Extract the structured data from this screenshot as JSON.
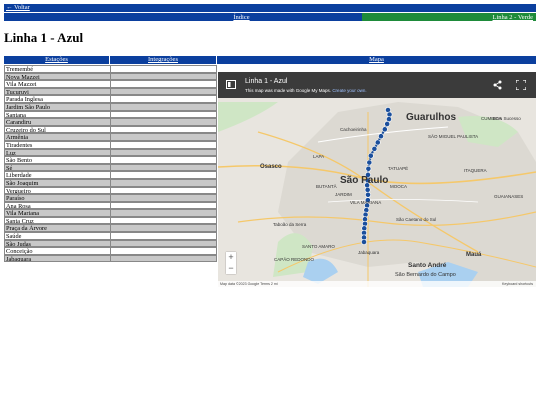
{
  "nav": {
    "back": "← Voltar",
    "index": "Índice",
    "next": "Linha 2 - Verde"
  },
  "page_title": "Linha 1 - Azul",
  "table_headers": {
    "stations": "Estações",
    "integrations": "Integrações",
    "map": "Mapa"
  },
  "stations": [
    "Tremembé",
    "Nova Mazzei",
    "Vila Mazzei",
    "Tucuruvi",
    "Parada Inglesa",
    "Jardim São Paulo",
    "Santana",
    "Carandiru",
    "Cruzeiro do Sul",
    "Armênia",
    "Tiradentes",
    "Luz",
    "São Bento",
    "Sé",
    "Liberdade",
    "São Joaquim",
    "Vergueiro",
    "Paraíso",
    "Ana Rosa",
    "Vila Mariana",
    "Santa Cruz",
    "Praça da Árvore",
    "Saúde",
    "São Judas",
    "Conceição",
    "Jabaquara"
  ],
  "map": {
    "title": "Linha 1 - Azul",
    "subtitle_prefix": "This map was made with Google My Maps.",
    "subtitle_link": "Create your own.",
    "share_icon": "share-icon",
    "fullscreen_icon": "fullscreen-icon",
    "labels": {
      "guarulhos": "Guarulhos",
      "saopaulo": "São Paulo",
      "osasco": "Osasco",
      "lapa": "LAPA",
      "butanta": "BUTANTÃ",
      "santoandre": "Santo André",
      "saobernardo": "São Bernardo do Campo",
      "maua": "Mauá",
      "itaquera": "ITAQUERA",
      "guaianases": "GUAIANASES",
      "cumbica": "CUMBICA",
      "tatuape": "TATUAPÉ",
      "saomiguel": "SÃO MIGUEL PAULISTA",
      "santoamaro": "SANTO AMARO",
      "jabaquara": "Jabaquara",
      "capao": "CAPÃO REDONDO",
      "taboao": "Taboão da Serra",
      "saocaetano": "São Caetano do Sul",
      "cachoeirinha": "Cachoeirinha",
      "jardim": "JARDIM",
      "vilamariana": "VILA MARIANA",
      "bonsucesso": "Bom Sucesso",
      "mooca": "MOOCA"
    },
    "footer": "Map data ©2023 Google   Terms   2 mi",
    "keyboard": "Keyboard shortcuts",
    "zoom_in": "+",
    "zoom_out": "−",
    "line_color": "#1b4f9c",
    "stop_count": 26
  },
  "colors": {
    "blue": "#0b3f9e",
    "green": "#1e8b3a",
    "grey_row": "#c8c8c8"
  }
}
